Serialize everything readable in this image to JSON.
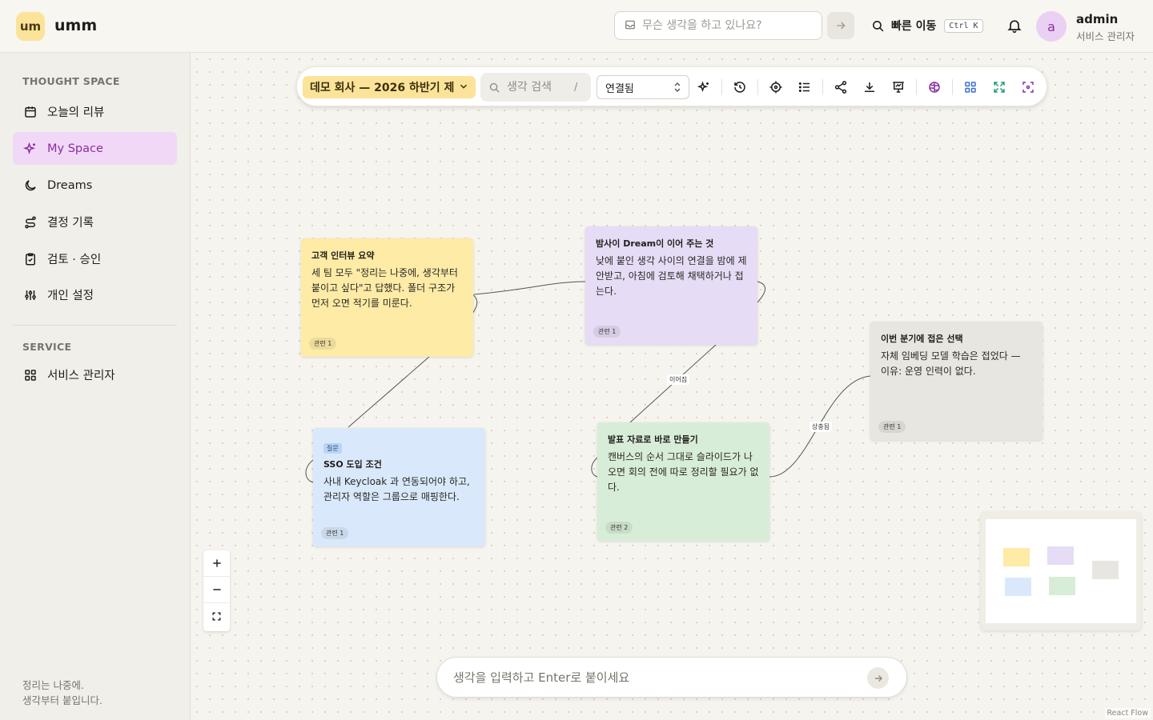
{
  "header": {
    "logo_mark": "um",
    "logo_text": "umm",
    "thought_placeholder": "무슨 생각을 하고 있나요?",
    "quick_nav_label": "빠른 이동",
    "quick_nav_shortcut": "Ctrl K",
    "user_initial": "a",
    "user_name": "admin",
    "user_role": "서비스 관리자"
  },
  "sidebar": {
    "section_thought": "THOUGHT SPACE",
    "items": [
      {
        "label": "오늘의 리뷰",
        "icon": "calendar-icon"
      },
      {
        "label": "My Space",
        "icon": "sparkles-icon",
        "active": true
      },
      {
        "label": "Dreams",
        "icon": "moon-icon"
      },
      {
        "label": "결정 기록",
        "icon": "route-icon"
      },
      {
        "label": "검토 · 승인",
        "icon": "clipboard-check-icon"
      },
      {
        "label": "개인 설정",
        "icon": "sliders-icon"
      }
    ],
    "section_service": "SERVICE",
    "service_items": [
      {
        "label": "서비스 관리자",
        "icon": "grid-icon"
      }
    ],
    "footer_line1": "정리는 나중에.",
    "footer_line2": "생각부터 붙입니다."
  },
  "toolbar": {
    "space_name": "데모 회사 — 2026 하반기 제",
    "search_placeholder": "생각 검색",
    "search_shortcut": "/",
    "filter_value": "연결됨"
  },
  "nodes": [
    {
      "title": "고객 인터뷰 요약",
      "body": "세 팀 모두 \"정리는 나중에, 생각부터 붙이고 싶다\"고 답했다. 폴더 구조가 먼저 오면 적기를 미룬다.",
      "badge": "관련 1",
      "color": "#fdeba6"
    },
    {
      "title": "밤사이 Dream이 이어 주는 것",
      "body": "낮에 붙인 생각 사이의 연결을 밤에 제안받고, 아침에 검토해 채택하거나 접는다.",
      "badge": "관련 1",
      "color": "#e6dcf6"
    },
    {
      "title": "이번 분기에 접은 선택",
      "body": "자체 임베딩 모델 학습은 접었다 — 이유: 운영 인력이 없다.",
      "badge": "관련 1",
      "color": "#e8e6e0"
    },
    {
      "tag": "질문",
      "title": "SSO 도입 조건",
      "body": "사내 Keycloak 과 연동되어야 하고, 관리자 역할은 그룹으로 매핑한다.",
      "badge": "관련 1",
      "color": "#d9e9fb"
    },
    {
      "title": "발표 자료로 바로 만들기",
      "body": "캔버스의 순서 그대로 슬라이드가 나오면 회의 전에 따로 정리할 필요가 없다.",
      "badge": "관련 2",
      "color": "#d8edd8"
    }
  ],
  "edges": [
    {
      "label": "이어짐"
    },
    {
      "label": "상충됨"
    }
  ],
  "composer": {
    "placeholder": "생각을 입력하고 Enter로 붙이세요"
  },
  "attribution": "React Flow"
}
